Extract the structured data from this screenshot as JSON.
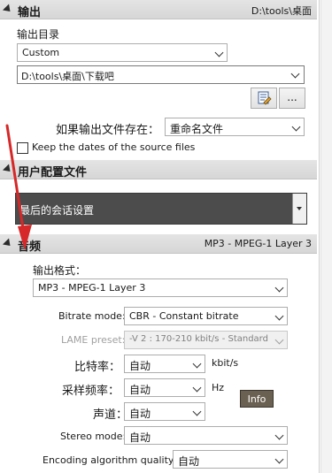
{
  "output": {
    "title": "输出",
    "summary": "D:\\tools\\桌面",
    "dir_label": "输出目录",
    "dir_mode": "Custom",
    "dir_path": "D:\\tools\\桌面\\下载吧",
    "browse_label": "...",
    "exists_label": "如果输出文件存在：",
    "exists_value": "重命名文件",
    "keep_dates_label": "Keep the dates of the source files"
  },
  "profile": {
    "title": "用户配置文件",
    "value": "最后的会话设置"
  },
  "audio": {
    "title": "音频",
    "summary": "MP3 - MPEG-1 Layer 3",
    "format_label": "输出格式：",
    "format_value": "MP3 - MPEG-1 Layer 3",
    "bitrate_mode_label": "Bitrate mode:",
    "bitrate_mode_value": "CBR - Constant bitrate",
    "lame_label": "LAME preset:",
    "lame_value": "-V 2 : 170-210 kbit/s - Standard",
    "bitrate_label": "比特率：",
    "bitrate_value": "自动",
    "bitrate_unit": "kbit/s",
    "samplerate_label": "采样频率：",
    "samplerate_value": "自动",
    "samplerate_unit": "Hz",
    "channels_label": "声道：",
    "channels_value": "自动",
    "info_label": "Info",
    "stereo_label": "Stereo mode:",
    "stereo_value": "自动",
    "quality_label": "Encoding algorithm quality:",
    "quality_value": "自动"
  },
  "colors": {
    "annotation_arrow": "#d62828",
    "profile_bg": "#4c4c4c",
    "info_bg": "#6b6152"
  }
}
